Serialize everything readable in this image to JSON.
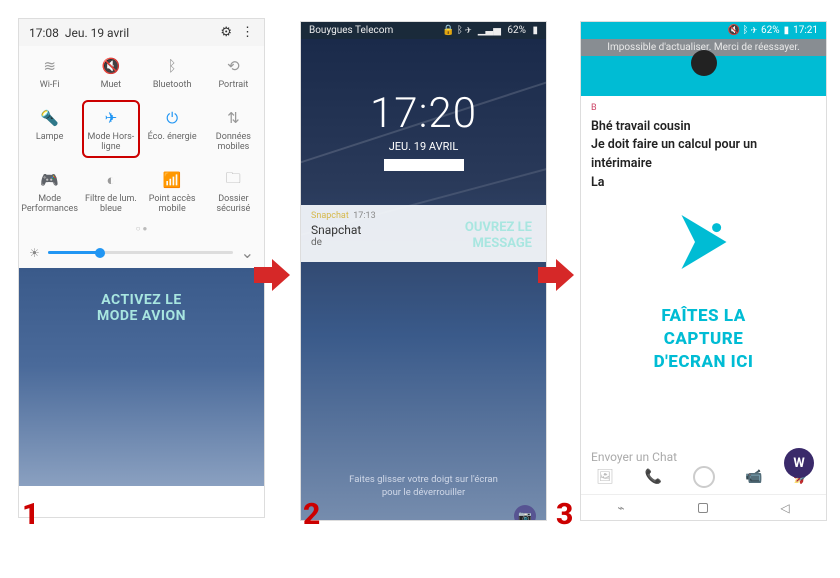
{
  "steps": {
    "one": "1",
    "two": "2",
    "three": "3"
  },
  "phone1": {
    "status": {
      "time": "17:08",
      "date": "Jeu. 19 avril"
    },
    "settings_icon": "⚙",
    "tiles": [
      {
        "label": "Wi-Fi",
        "icon": "≋"
      },
      {
        "label": "Muet",
        "icon": "🔇"
      },
      {
        "label": "Bluetooth",
        "icon": "ᛒ"
      },
      {
        "label": "Portrait",
        "icon": "⟲"
      },
      {
        "label": "Lampe",
        "icon": "🔦"
      },
      {
        "label": "Mode Hors-ligne",
        "icon": "✈"
      },
      {
        "label": "Éco. énergie",
        "icon": "⏻"
      },
      {
        "label": "Données mobiles",
        "icon": "⇅"
      },
      {
        "label": "Mode Performances",
        "icon": "🎮"
      },
      {
        "label": "Filtre de lum. bleue",
        "icon": "◐"
      },
      {
        "label": "Point accès mobile",
        "icon": "📶"
      },
      {
        "label": "Dossier sécurisé",
        "icon": "🗀"
      }
    ],
    "brightness_icon": "☀",
    "dropdown_icon": "⌄",
    "caption_l1": "ACTIVEZ LE",
    "caption_l2": "MODE AVION"
  },
  "phone2": {
    "status": {
      "carrier": "Bouygues Telecom",
      "battery": "62%",
      "icons": "🔒 ᛒ ✈"
    },
    "clock": {
      "time": "17:20",
      "date": "JEU. 19 AVRIL"
    },
    "notification": {
      "app": "Snapchat",
      "time": "17:13",
      "title": "Snapchat",
      "from": "de"
    },
    "caption_l1": "OUVREZ LE",
    "caption_l2": "MESSAGE",
    "hint_l1": "Faites glisser votre doigt sur l'écran",
    "hint_l2": "pour le déverrouiller",
    "camera_icon": "📷"
  },
  "phone3": {
    "status": {
      "icons": "🔇 ᛒ ✈",
      "battery": "62%",
      "time": "17:21"
    },
    "banner": "Impossible d'actualiser. Merci de réessayer.",
    "chat": {
      "label": "B",
      "line1": "Bhé travail cousin",
      "line2": "Je doit faire un calcul pour un intérimaire",
      "line3": "La"
    },
    "caption_l1": "FAÎTES LA",
    "caption_l2": "CAPTURE",
    "caption_l3": "D'ECRAN ICI",
    "input_placeholder": "Envoyer un Chat",
    "bottombar": {
      "gallery": "🖼",
      "call": "📞",
      "video": "📹",
      "rocket": "🚀"
    },
    "nav": {
      "recent": "⌁",
      "home": "▢",
      "back": "◁"
    },
    "fab": "W"
  }
}
